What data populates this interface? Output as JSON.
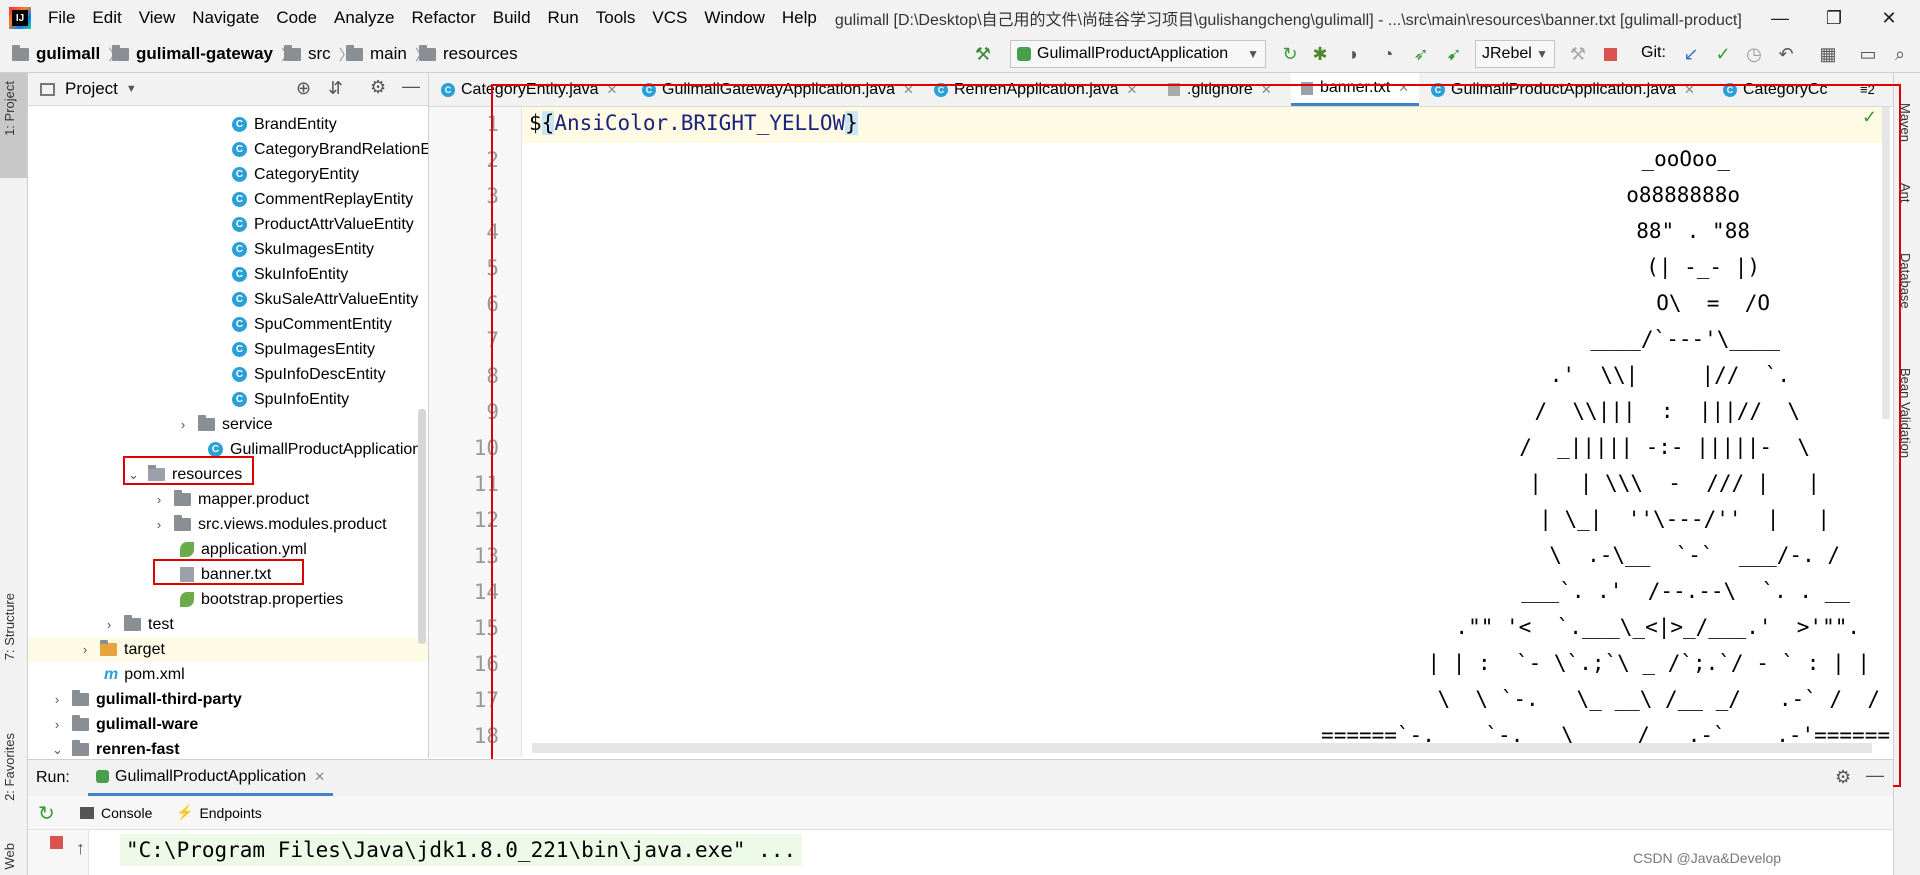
{
  "menubar": {
    "items": [
      "File",
      "Edit",
      "View",
      "Navigate",
      "Code",
      "Analyze",
      "Refactor",
      "Build",
      "Run",
      "Tools",
      "VCS",
      "Window",
      "Help"
    ],
    "window_title": "gulimall [D:\\Desktop\\自己用的文件\\尚硅谷学习项目\\gulishangcheng\\gulimall] - ...\\src\\main\\resources\\banner.txt [gulimall-product]"
  },
  "navbar": {
    "breadcrumbs": [
      "gulimall",
      "gulimall-gateway",
      "src",
      "main",
      "resources"
    ],
    "run_config": "GulimallProductApplication",
    "jrebel": "JRebel",
    "git_label": "Git:"
  },
  "project": {
    "title": "Project",
    "items": [
      {
        "label": "BrandEntity"
      },
      {
        "label": "CategoryBrandRelationE"
      },
      {
        "label": "CategoryEntity"
      },
      {
        "label": "CommentReplayEntity"
      },
      {
        "label": "ProductAttrValueEntity"
      },
      {
        "label": "SkuImagesEntity"
      },
      {
        "label": "SkuInfoEntity"
      },
      {
        "label": "SkuSaleAttrValueEntity"
      },
      {
        "label": "SpuCommentEntity"
      },
      {
        "label": "SpuImagesEntity"
      },
      {
        "label": "SpuInfoDescEntity"
      },
      {
        "label": "SpuInfoEntity"
      },
      {
        "label": "service"
      },
      {
        "label": "GulimallProductApplication"
      },
      {
        "label": "resources"
      },
      {
        "label": "mapper.product"
      },
      {
        "label": "src.views.modules.product"
      },
      {
        "label": "application.yml"
      },
      {
        "label": "banner.txt"
      },
      {
        "label": "bootstrap.properties"
      },
      {
        "label": "test"
      },
      {
        "label": "target"
      },
      {
        "label": "pom.xml"
      },
      {
        "label": "gulimall-third-party"
      },
      {
        "label": "gulimall-ware"
      },
      {
        "label": "renren-fast"
      }
    ]
  },
  "left_stripe": {
    "project": "1: Project",
    "structure": "7: Structure",
    "favorites": "2: Favorites",
    "web": "Web"
  },
  "right_stripe": {
    "maven": "Maven",
    "ant": "Ant",
    "database": "Database",
    "bean": "Bean Validation"
  },
  "editor": {
    "tabs": [
      "CategoryEntity.java",
      "GulimallGatewayApplication.java",
      "RenrenApplication.java",
      ".gitignore",
      "banner.txt",
      "GulimallProductApplication.java",
      "CategoryCc"
    ],
    "tab_overflow": "≡2",
    "line_numbers": [
      "1",
      "2",
      "3",
      "4",
      "5",
      "6",
      "7",
      "8",
      "9",
      "10",
      "11",
      "12",
      "13",
      "14",
      "15",
      "16",
      "17",
      "18"
    ],
    "line1": {
      "dollar": "$",
      "open": "{",
      "expr": "AnsiColor.BRIGHT_YELLOW",
      "close": "}"
    },
    "art": [
      "_ooOoo_",
      "o8888888o",
      "88\" . \"88",
      "(| -_- |)",
      "O\\  =  /O",
      "____/`---'\\____",
      ".'  \\\\|     |//  `.",
      "/  \\\\|||  :  |||//  \\",
      "/  _||||| -:- |||||-  \\",
      "|   | \\\\\\  -  /// |   |",
      "| \\_|  ''\\---/''  |   |",
      "\\  .-\\__  `-`  ___/-. /",
      "___`. .'  /--.--\\  `. . __",
      ".\"\" '<  `.___\\_<|>_/___.'  >'\"\".",
      "| | :  `- \\`.;`\\ _ /`;.`/ - ` : | |",
      "\\  \\ `-.   \\_ __\\ /__ _/   .-` /  /",
      "======`-.____`-.___\\_____/___.-`____.-'======"
    ]
  },
  "run": {
    "label": "Run:",
    "tab": "GulimallProductApplication",
    "console_tab": "Console",
    "endpoints_tab": "Endpoints",
    "console_line": "\"C:\\Program Files\\Java\\jdk1.8.0_221\\bin\\java.exe\" ..."
  },
  "watermark": "CSDN @Java&Develop"
}
